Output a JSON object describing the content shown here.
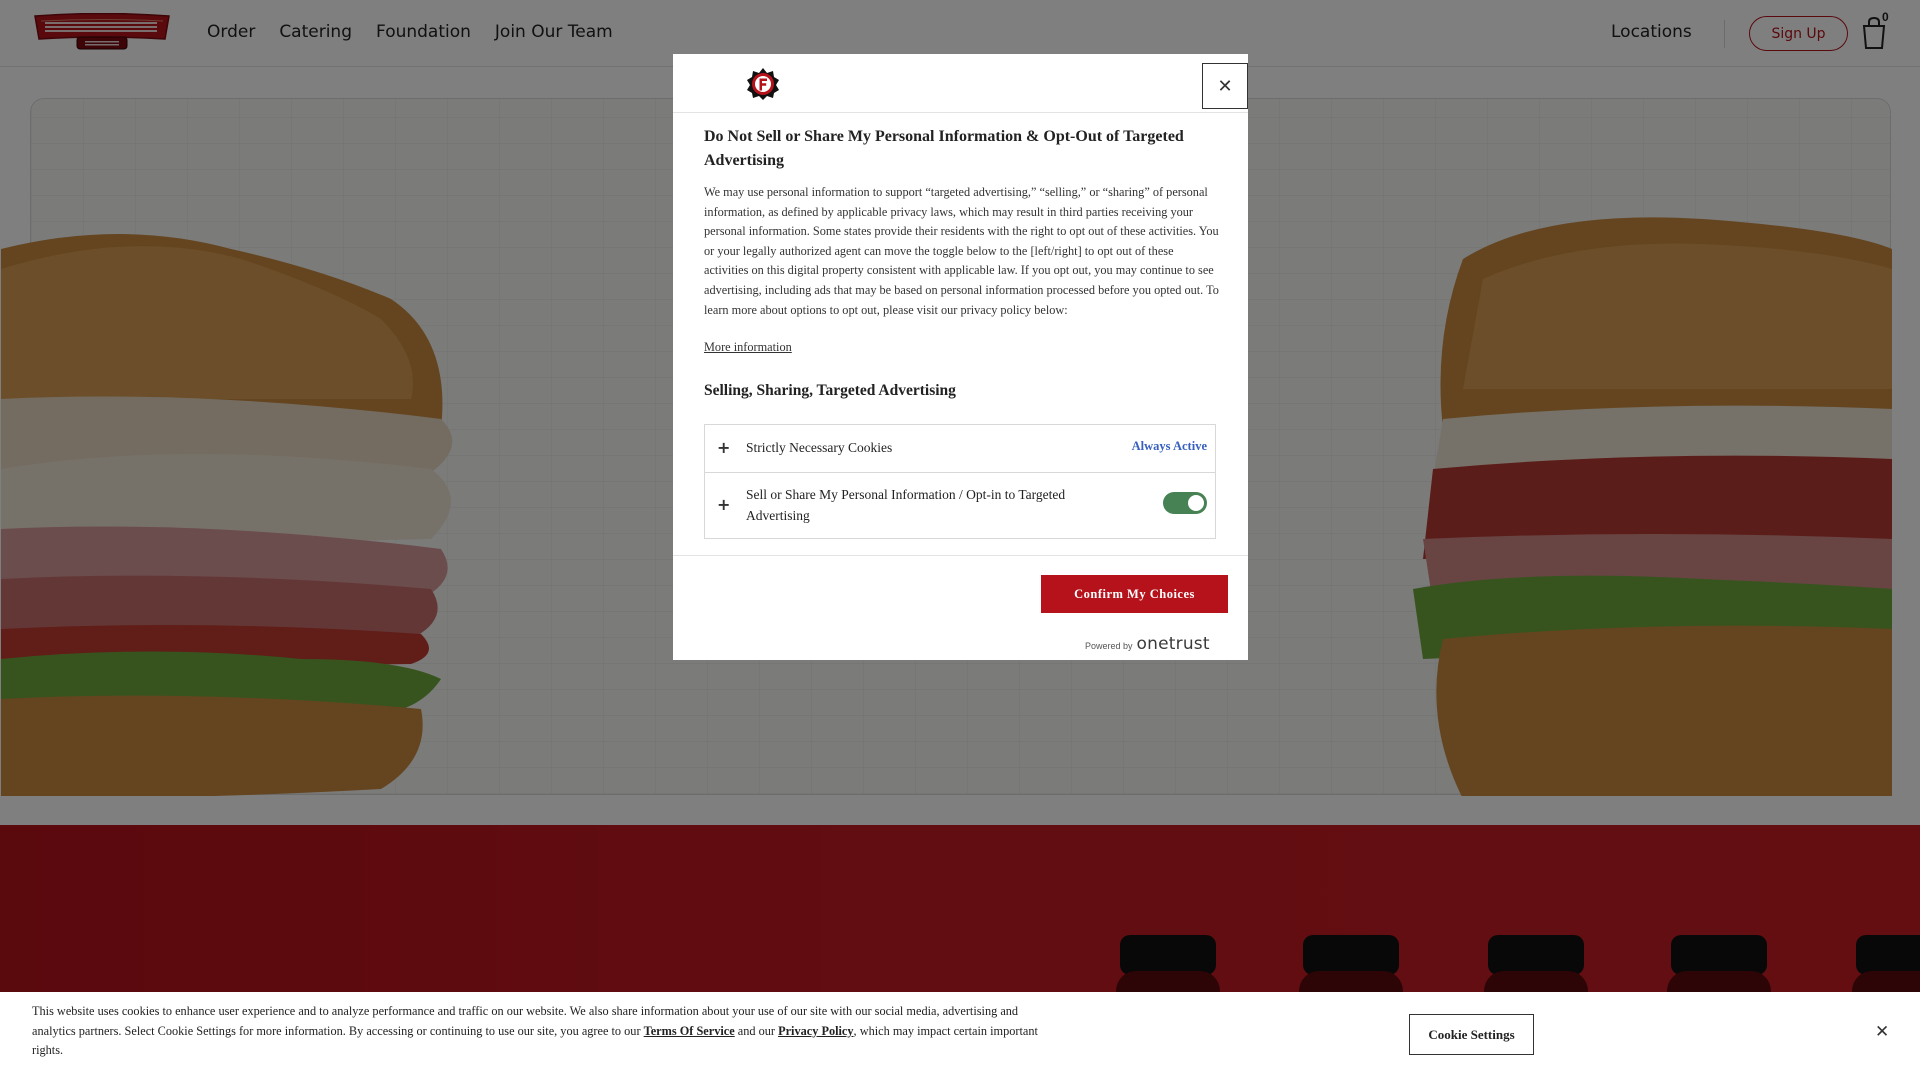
{
  "header": {
    "nav": [
      "Order",
      "Catering",
      "Foundation",
      "Join Our Team"
    ],
    "locations": "Locations",
    "signup": "Sign Up",
    "cart_count": "0",
    "logo_icon": "firehouse-subs-logo",
    "cart_icon": "shopping-bag-icon"
  },
  "colors": {
    "brand_red": "#b5121b",
    "link_blue": "#3860be",
    "toggle_green": "#468254"
  },
  "modal": {
    "title": "Do Not Sell or Share My Personal Information & Opt-Out of Targeted Advertising",
    "description": "We may use personal information to support “targeted advertising,” “selling,” or “sharing” of personal information, as defined by applicable privacy laws, which may result in third parties receiving your personal information. Some states provide their residents with the right to opt out of these activities. You or your legally authorized agent can move the toggle below to the [left/right] to opt out of these activities on this digital property consistent with applicable law. If you opt out, you may continue to see advertising, including ads that may be based on personal information processed before you opted out. To learn more about options to opt out, please visit our privacy policy below:",
    "more_info": "More information",
    "section_title": "Selling, Sharing, Targeted Advertising",
    "preferences": [
      {
        "label": "Strictly Necessary Cookies",
        "status": "Always Active"
      },
      {
        "label": "Sell or Share My Personal Information / Opt-in to Targeted Advertising",
        "enabled": true
      }
    ],
    "confirm_button": "Confirm My Choices",
    "powered_by": "Powered by",
    "onetrust": "onetrust",
    "close": "✕"
  },
  "cookie_banner": {
    "text_1": "This website uses cookies to enhance user experience and to analyze performance and traffic on our website. We also share information about your use of our site with our social media, advertising and analytics partners. Select Cookie Settings for more information. By accessing or continuing to use our site, you agree to our ",
    "terms_link": "Terms Of Service",
    "text_2": " and our ",
    "privacy_link": "Privacy Policy",
    "text_3": ", which may impact certain important rights.",
    "settings_button": "Cookie Settings",
    "close": "✕"
  }
}
